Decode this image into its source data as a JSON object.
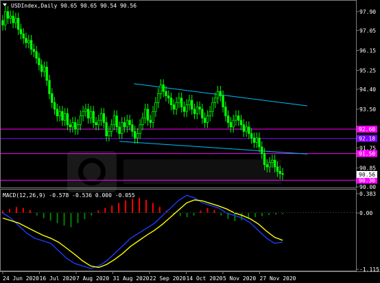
{
  "window": {
    "title": "USDIndex,Daily",
    "ohlc": "90.65 90.65 90.54 90.56"
  },
  "main_scale": {
    "ticks": [
      "97.90",
      "97.05",
      "96.15",
      "95.25",
      "94.40",
      "93.50",
      "92.60",
      "91.75",
      "90.85",
      "90.00"
    ],
    "level_labels": [
      "92.60",
      "92.18",
      "91.50",
      "90.30"
    ],
    "current_price": "90.56"
  },
  "macd": {
    "label": "MACD(12,26,9) -0.578 -0.536 0.000 -0.055",
    "ticks": [
      "0.383",
      "0.00",
      "-1.115"
    ]
  },
  "time_axis": {
    "labels": [
      "24 Jun 2020",
      "16 Jul 2020",
      "7 Aug 2020",
      "31 Aug 2020",
      "22 Sep 2020",
      "14 Oct 2020",
      "5 Nov 2020",
      "27 Nov 2020"
    ]
  },
  "colors": {
    "background": "#000000",
    "candle": "#00ff00",
    "trendline": "#00bfff",
    "support_resistance": "#ff00ff",
    "level_purple": "#8000ff",
    "macd_up": "#ff0000",
    "macd_down": "#008000",
    "macd_line": "#1c3cff",
    "signal_line": "#ffff00"
  },
  "chart_data": {
    "type": "candlestick",
    "symbol": "USDIndex",
    "timeframe": "Daily",
    "ylim": [
      90.0,
      98.3
    ],
    "close_series": [
      97.3,
      97.9,
      97.6,
      97.7,
      97.4,
      97.6,
      97.1,
      96.9,
      96.7,
      96.5,
      96.6,
      96.2,
      96.1,
      95.8,
      95.5,
      95.2,
      95.4,
      94.8,
      94.2,
      93.8,
      93.5,
      93.2,
      93.4,
      93.0,
      93.3,
      92.8,
      92.7,
      92.9,
      92.6,
      92.8,
      93.2,
      93.4,
      93.5,
      93.1,
      93.4,
      92.9,
      92.8,
      93.0,
      93.3,
      92.9,
      92.3,
      92.5,
      92.8,
      93.2,
      92.7,
      92.4,
      92.9,
      92.7,
      93.0,
      92.8,
      92.5,
      92.2,
      92.4,
      92.8,
      93.1,
      93.5,
      93.0,
      92.9,
      93.4,
      93.8,
      94.2,
      94.6,
      94.3,
      94.1,
      94.0,
      93.7,
      93.5,
      93.8,
      94.0,
      93.6,
      93.4,
      93.7,
      93.9,
      93.5,
      93.3,
      93.6,
      93.5,
      93.1,
      92.9,
      93.2,
      93.4,
      93.8,
      94.0,
      94.3,
      94.1,
      93.6,
      93.2,
      92.9,
      92.7,
      93.0,
      93.2,
      93.0,
      92.8,
      92.5,
      92.7,
      92.4,
      92.2,
      92.0,
      92.2,
      91.8,
      91.5,
      91.0,
      90.9,
      91.1,
      91.2,
      90.9,
      90.7,
      90.6,
      90.56
    ],
    "lines": [
      {
        "type": "trendline",
        "from": [
          "2020-09-04",
          94.65
        ],
        "to": [
          "2020-12-08",
          93.65
        ]
      },
      {
        "type": "trendline",
        "from": [
          "2020-08-27",
          92.05
        ],
        "to": [
          "2020-12-08",
          91.48
        ]
      },
      {
        "type": "horizontal",
        "value": 92.6
      },
      {
        "type": "horizontal",
        "value": 92.18
      },
      {
        "type": "horizontal",
        "value": 91.5
      },
      {
        "type": "horizontal",
        "value": 90.3
      }
    ],
    "macd": {
      "params": [
        12,
        26,
        9
      ],
      "values": {
        "macd": -0.578,
        "signal": -0.536,
        "histogram": 0.0,
        "extra": -0.055
      },
      "ylim": [
        -1.115,
        0.383
      ],
      "macd_line": [
        0.0,
        -0.1,
        -0.25,
        -0.4,
        -0.5,
        -0.55,
        -0.6,
        -0.75,
        -0.9,
        -1.0,
        -1.05,
        -1.1,
        -1.05,
        -0.95,
        -0.8,
        -0.65,
        -0.5,
        -0.4,
        -0.3,
        -0.2,
        -0.05,
        0.1,
        0.25,
        0.35,
        0.3,
        0.2,
        0.15,
        0.1,
        0.0,
        -0.05,
        -0.1,
        -0.2,
        -0.35,
        -0.5,
        -0.6,
        -0.58
      ],
      "signal_line": [
        -0.1,
        -0.15,
        -0.2,
        -0.28,
        -0.36,
        -0.44,
        -0.5,
        -0.58,
        -0.7,
        -0.82,
        -0.95,
        -1.05,
        -1.08,
        -1.02,
        -0.92,
        -0.8,
        -0.66,
        -0.55,
        -0.44,
        -0.34,
        -0.22,
        -0.08,
        0.06,
        0.2,
        0.26,
        0.24,
        0.19,
        0.14,
        0.08,
        0.0,
        -0.05,
        -0.12,
        -0.22,
        -0.36,
        -0.48,
        -0.54
      ],
      "histogram": [
        0.05,
        0.08,
        0.12,
        0.1,
        0.06,
        -0.05,
        -0.1,
        -0.15,
        -0.2,
        -0.25,
        -0.28,
        -0.2,
        -0.12,
        -0.05,
        0.05,
        0.1,
        0.15,
        0.2,
        0.25,
        0.28,
        0.3,
        0.26,
        0.2,
        0.12,
        0.05,
        -0.02,
        -0.06,
        -0.08,
        -0.05,
        0.05,
        0.1,
        0.06,
        -0.05,
        -0.12,
        -0.16,
        -0.14,
        -0.1,
        -0.08,
        -0.06,
        -0.04,
        -0.03,
        -0.02
      ]
    }
  }
}
